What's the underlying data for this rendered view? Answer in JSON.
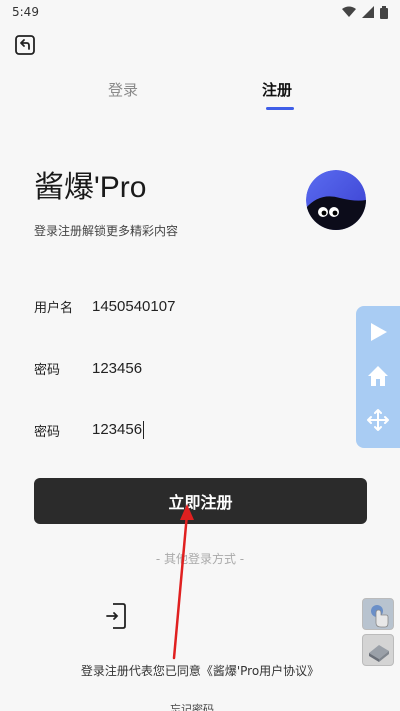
{
  "status_bar": {
    "time": "5:49"
  },
  "tabs": {
    "login": "登录",
    "register": "注册"
  },
  "header": {
    "title": "酱爆'Pro",
    "subtitle": "登录注册解锁更多精彩内容"
  },
  "form": {
    "username_label": "用户名",
    "username_value": "1450540107",
    "password_label": "密码",
    "password_value": "123456",
    "confirm_label": "密码",
    "confirm_value": "123456"
  },
  "submit_label": "立即注册",
  "other_login": "- 其他登录方式 -",
  "agreement": "登录注册代表您已同意《酱爆'Pro用户协议》",
  "bottom_partial": "忘记密码",
  "colors": {
    "accent": "#3f5ee8",
    "button": "#2b2b2b",
    "float_panel": "#a9ccf3",
    "arrow": "#e02020"
  },
  "icons": {
    "back": "back-arrow-icon",
    "float_play": "play-icon",
    "float_home": "home-icon",
    "float_move": "move-icon",
    "phone_login": "phone-login-icon"
  }
}
